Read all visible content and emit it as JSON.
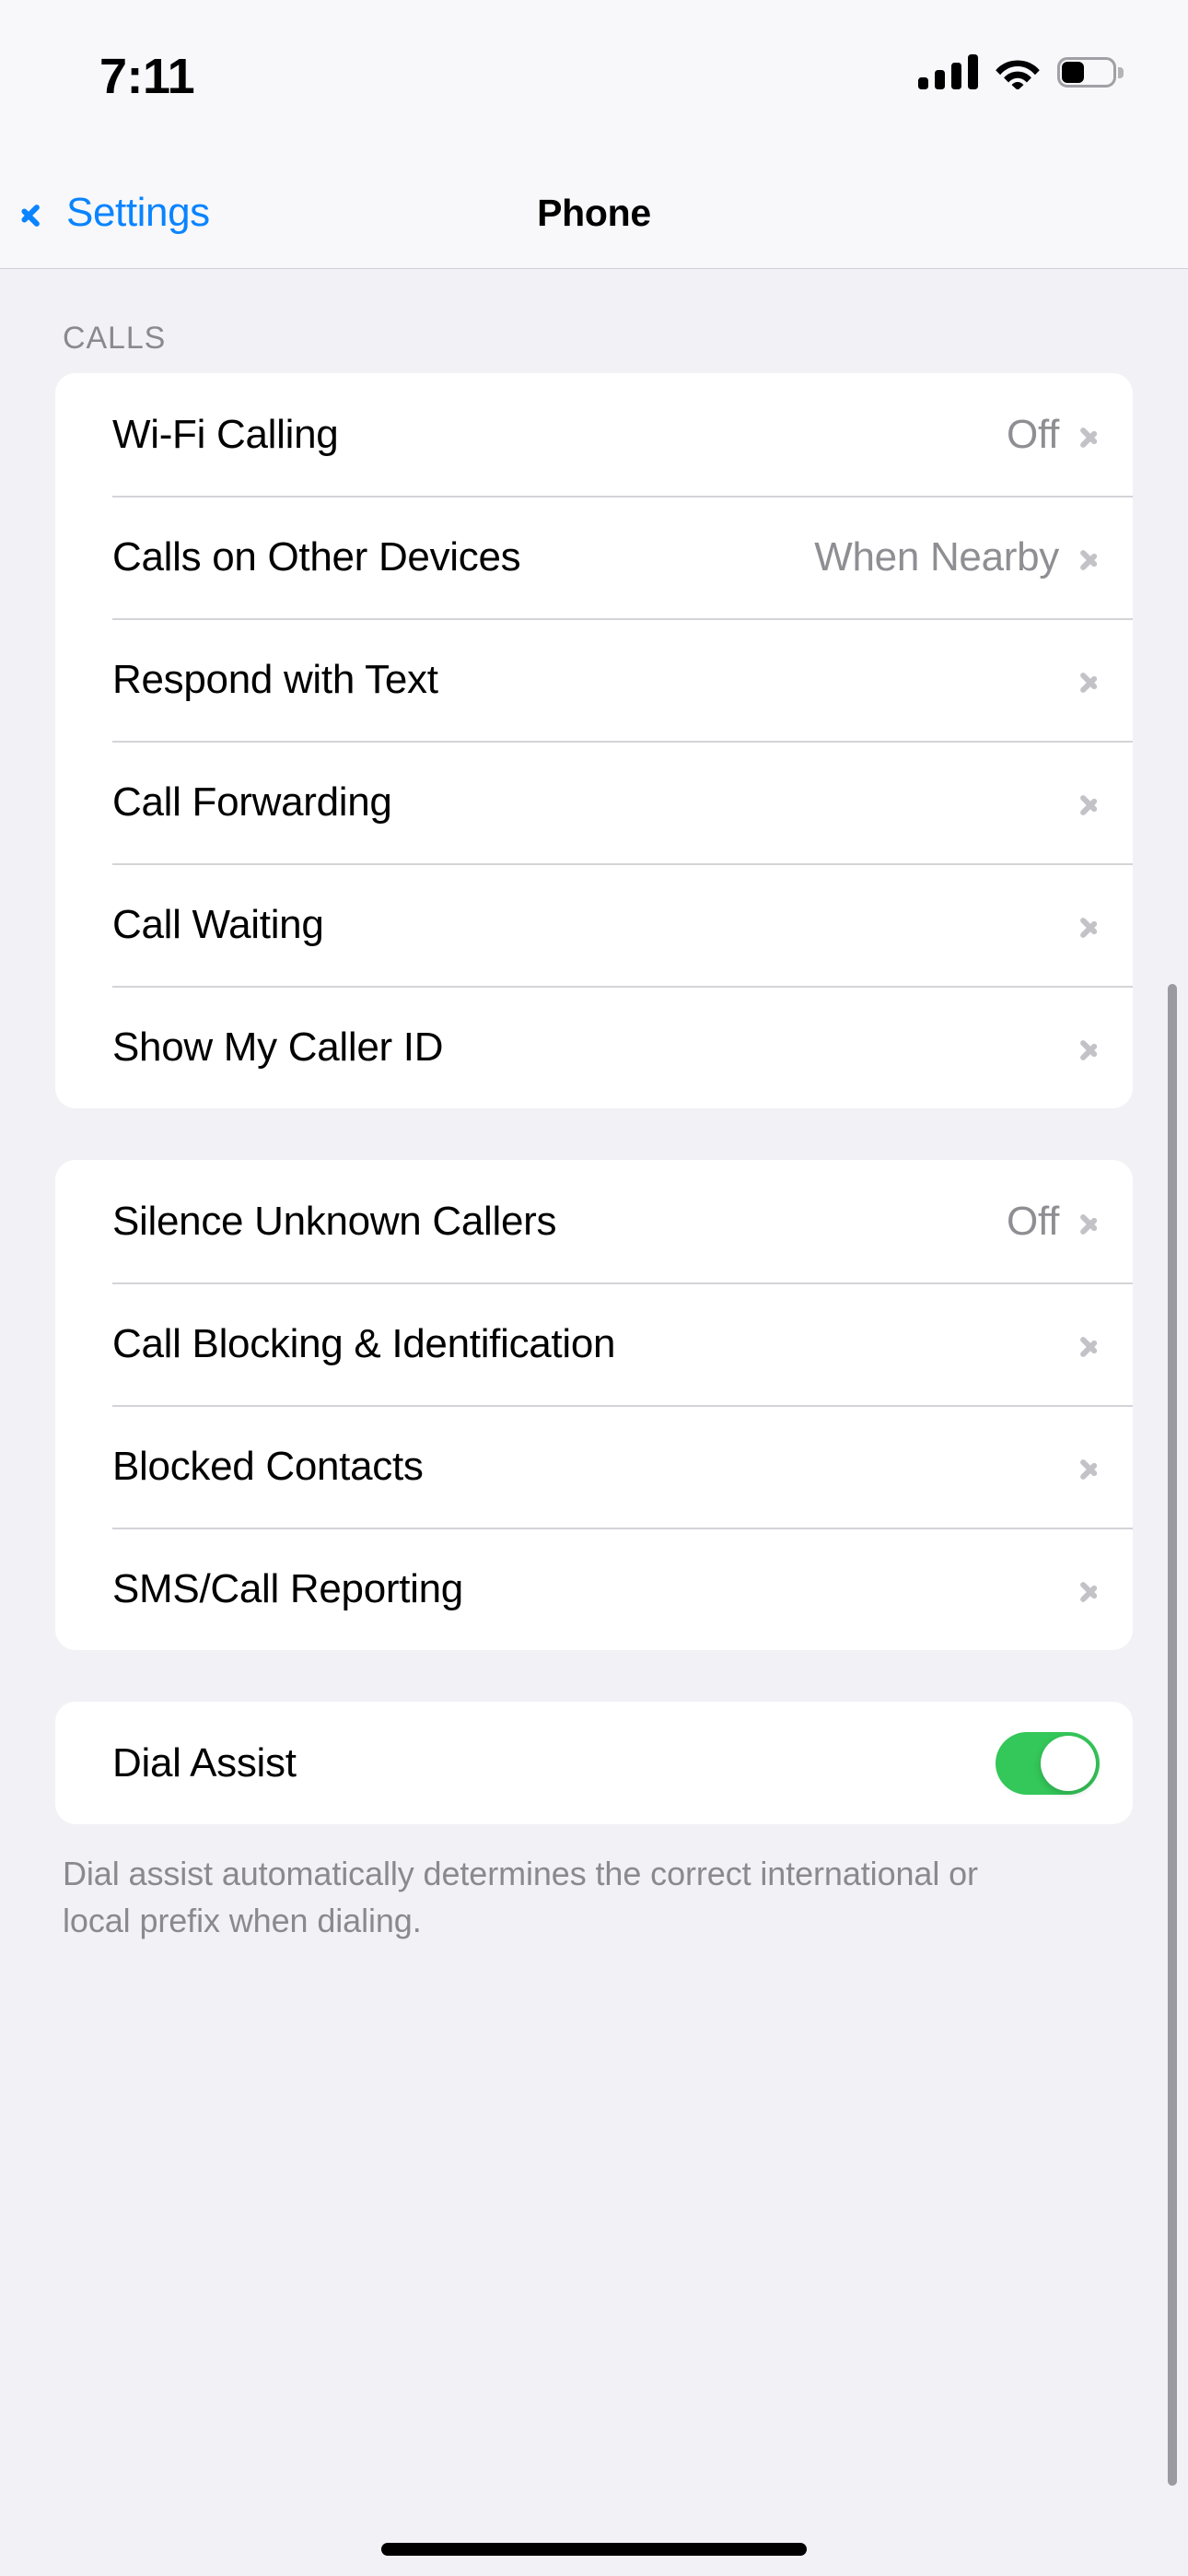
{
  "status_bar": {
    "time": "7:11",
    "signal_icon": "cellular-signal-icon",
    "signal_bars_filled": 4,
    "wifi_icon": "wifi-icon",
    "battery_icon": "battery-icon",
    "battery_percent": 45
  },
  "nav": {
    "back_label": "Settings",
    "back_icon": "chevron-left-icon",
    "title": "Phone"
  },
  "sections": [
    {
      "header": "CALLS",
      "rows": [
        {
          "label": "Wi-Fi Calling",
          "value": "Off",
          "accessory": "chevron"
        },
        {
          "label": "Calls on Other Devices",
          "value": "When Nearby",
          "accessory": "chevron"
        },
        {
          "label": "Respond with Text",
          "value": "",
          "accessory": "chevron"
        },
        {
          "label": "Call Forwarding",
          "value": "",
          "accessory": "chevron"
        },
        {
          "label": "Call Waiting",
          "value": "",
          "accessory": "chevron"
        },
        {
          "label": "Show My Caller ID",
          "value": "",
          "accessory": "chevron"
        }
      ]
    },
    {
      "header": "",
      "rows": [
        {
          "label": "Silence Unknown Callers",
          "value": "Off",
          "accessory": "chevron"
        },
        {
          "label": "Call Blocking & Identification",
          "value": "",
          "accessory": "chevron"
        },
        {
          "label": "Blocked Contacts",
          "value": "",
          "accessory": "chevron"
        },
        {
          "label": "SMS/Call Reporting",
          "value": "",
          "accessory": "chevron"
        }
      ]
    },
    {
      "header": "",
      "rows": [
        {
          "label": "Dial Assist",
          "value": "",
          "accessory": "toggle",
          "toggle_on": true
        }
      ],
      "footer": "Dial assist automatically determines the correct international or local prefix when dialing."
    }
  ],
  "colors": {
    "accent_blue": "#0a84ff",
    "toggle_green": "#34c759",
    "page_background": "#f1f1f6",
    "card_background": "#ffffff",
    "secondary_text": "#8e8e93"
  },
  "home_indicator": "home-indicator"
}
